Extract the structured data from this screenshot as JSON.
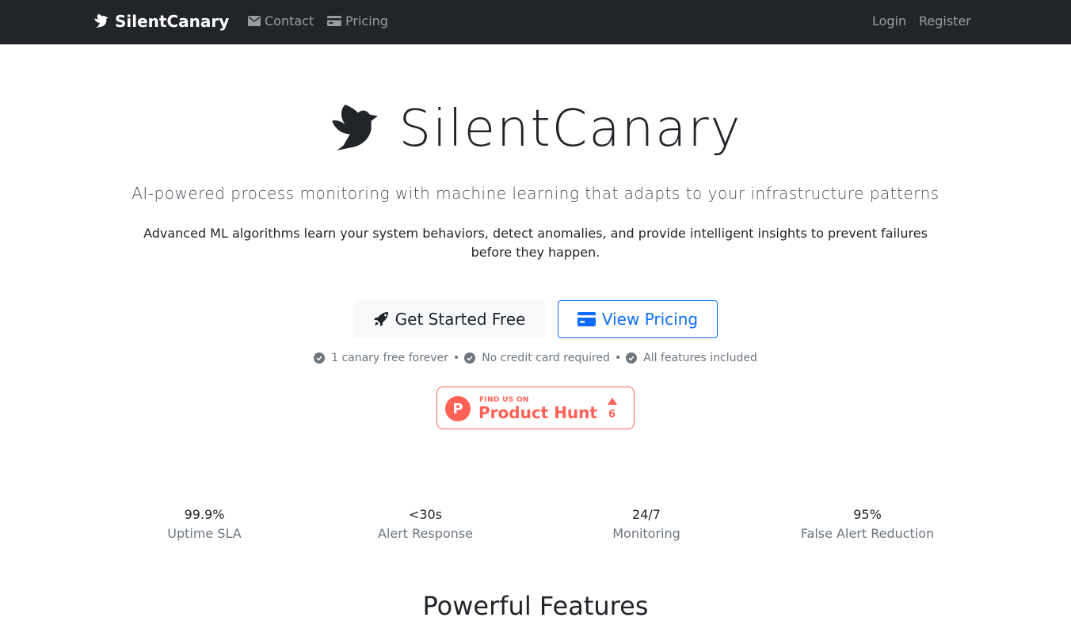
{
  "navbar": {
    "brand": "SilentCanary",
    "links": [
      {
        "label": "Contact",
        "icon": "envelope-icon"
      },
      {
        "label": "Pricing",
        "icon": "credit-card-icon"
      }
    ],
    "login": "Login",
    "register": "Register"
  },
  "hero": {
    "title": "SilentCanary",
    "subtitle": "AI-powered process monitoring with machine learning that adapts to your infrastructure patterns",
    "description": "Advanced ML algorithms learn your system behaviors, detect anomalies, and provide intelligent insights to prevent failures before they happen.",
    "primary_button": "Get Started Free",
    "secondary_button": "View Pricing"
  },
  "perks": [
    "1 canary free forever",
    "No credit card required",
    "All features included"
  ],
  "perk_separator": "•",
  "product_hunt": {
    "small_text": "FIND US ON",
    "big_text": "Product Hunt",
    "logo_letter": "P",
    "upvotes": "6"
  },
  "stats": [
    {
      "value": "99.9%",
      "label": "Uptime SLA"
    },
    {
      "value": "<30s",
      "label": "Alert Response"
    },
    {
      "value": "24/7",
      "label": "Monitoring"
    },
    {
      "value": "95%",
      "label": "False Alert Reduction"
    }
  ],
  "features_heading": "Powerful Features",
  "colors": {
    "navbar_bg": "#212529",
    "primary": "#0d6efd",
    "product_hunt": "#ff6154",
    "muted": "#6c757d"
  }
}
